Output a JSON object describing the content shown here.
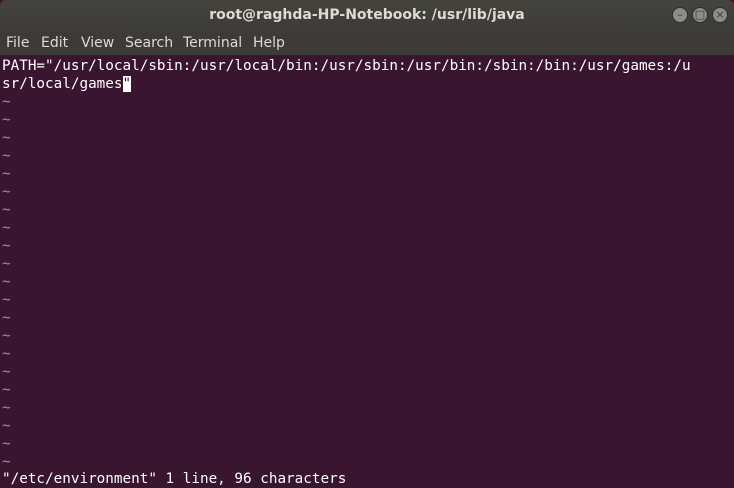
{
  "window": {
    "title": "root@raghda-HP-Notebook: /usr/lib/java",
    "buttons": {
      "minimize_icon": "minimize-icon",
      "maximize_icon": "maximize-icon",
      "close_icon": "close-icon"
    }
  },
  "menu": {
    "items": [
      "File",
      "Edit",
      "View",
      "Search",
      "Terminal",
      "Help"
    ]
  },
  "editor": {
    "line1": "PATH=\"/usr/local/sbin:/usr/local/bin:/usr/sbin:/usr/bin:/sbin:/bin:/usr/games:/u",
    "line2": "sr/local/games",
    "cursor_char": "\"",
    "tilde": "~",
    "status": "\"/etc/environment\" 1 line, 96 characters"
  },
  "colors": {
    "terminal_bg": "#3a1530",
    "tilde": "#8a8fd0",
    "text": "#ffffff"
  }
}
